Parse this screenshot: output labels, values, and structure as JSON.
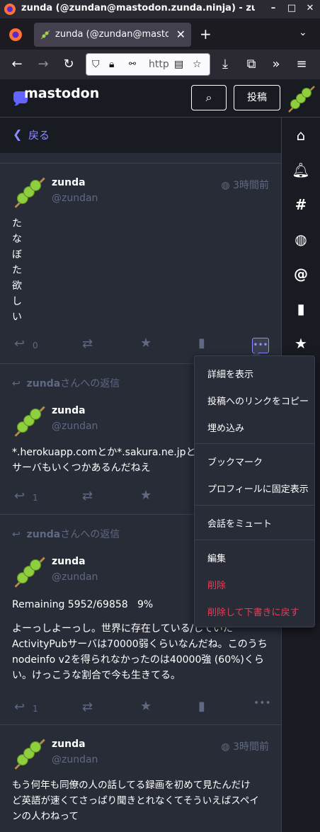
{
  "browser": {
    "window_title": "zunda (@zundan@mastodon.zunda.ninja) - zundon — Mozilla Firefox",
    "tab_title": "zunda (@zundan@mastodon.zunda.ninja) - zundon",
    "url_text": "http"
  },
  "header": {
    "logo_text": "mastodon",
    "post_label": "投稿"
  },
  "nav": {
    "back_label": "戻る"
  },
  "statuses": [
    {
      "reply_header": "",
      "name": "zunda",
      "handle": "@zundan",
      "time": "3時間前",
      "lines": [
        "た",
        "な",
        "ぼ",
        "た",
        "欲",
        "し",
        "い"
      ],
      "reply_count": "0"
    },
    {
      "reply_header_name": "zunda",
      "reply_header_suffix": "さんへの返信",
      "name": "zunda",
      "handle": "@zundan",
      "lines": [
        "*.herokuapp.comとか*.sakura.ne.jpとか",
        "サーバもいくつかあるんだねえ"
      ],
      "reply_count": "1"
    },
    {
      "reply_header_name": "zunda",
      "reply_header_suffix": "さんへの返信",
      "name": "zunda",
      "handle": "@zundan",
      "line1": "Remaining 5952/69858   9%",
      "lines": [
        "よーっしよーっし。世界に存在している/していた",
        "ActivityPubサーバは70000弱くらいなんだね。このうち",
        "nodeinfo v2を得られなかったのは40000強 (60%)くら",
        "い。けっこうな割合で今も生きてる。"
      ],
      "reply_count": "1"
    },
    {
      "name": "zunda",
      "handle": "@zundan",
      "time": "3時間前",
      "lines": [
        "もう何年も同僚の人の話してる録画を初めて見たんだけ",
        "ど英語が速くてさっぱり聞きとれなくてそういえばスペイ",
        "ンの人わねって"
      ]
    }
  ],
  "menu": {
    "items": [
      "詳細を表示",
      "投稿へのリンクをコピー",
      "埋め込み",
      "ブックマーク",
      "プロフィールに固定表示",
      "会話をミュート",
      "編集",
      "削除",
      "削除して下書きに戻す"
    ]
  },
  "colors": {
    "accent": "#8c8dff",
    "danger": "#df405a",
    "muted": "#606984",
    "column_bg": "#282c37",
    "page_bg": "#191b22"
  }
}
